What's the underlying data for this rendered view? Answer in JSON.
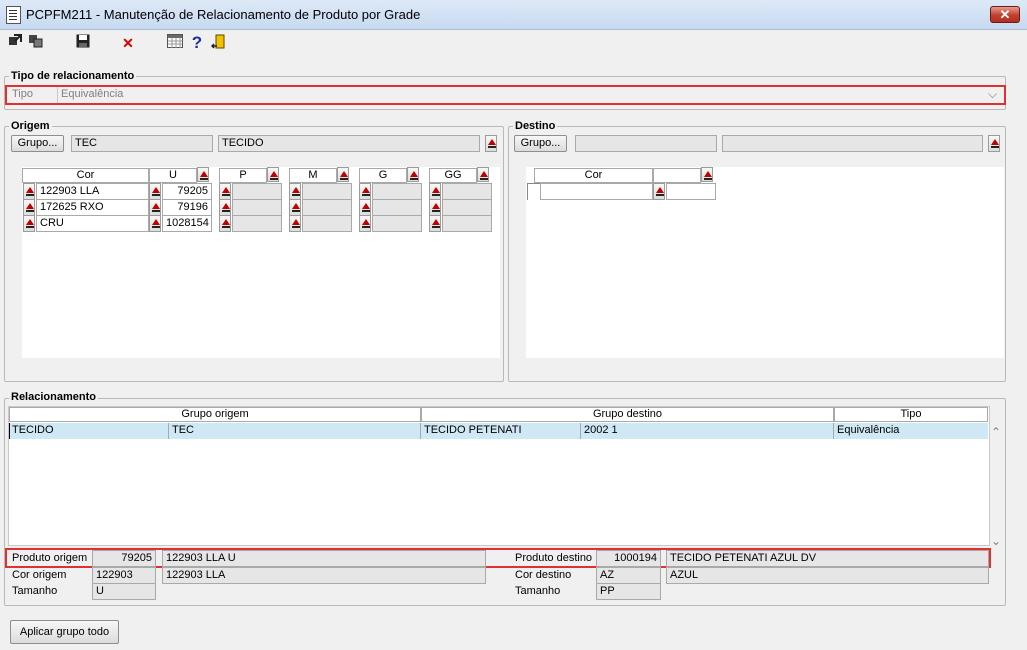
{
  "window": {
    "title": "PCPFM211 - Manutenção de Relacionamento de Produto por Grade",
    "close_label": "✕"
  },
  "toolbar": {
    "icons": [
      "export-icon",
      "copy-icon",
      "save-icon",
      "delete-icon",
      "calendar-icon",
      "help-icon",
      "exit-icon"
    ],
    "delete_glyph": "✕",
    "help_glyph": "?"
  },
  "tipo_rel": {
    "legend": "Tipo de relacionamento",
    "label": "Tipo",
    "value": "Equivalência",
    "arrow": "⌵"
  },
  "origem": {
    "legend": "Origem",
    "grupo_button": "Grupo...",
    "grupo_code": "TEC",
    "grupo_name": "TECIDO",
    "columns": [
      "Cor",
      "U",
      "P",
      "M",
      "G",
      "GG"
    ],
    "rows": [
      {
        "cor": "122903 LLA",
        "u": "79205"
      },
      {
        "cor": "172625 RXO",
        "u": "79196"
      },
      {
        "cor": "CRU",
        "u": "1028154"
      }
    ]
  },
  "destino": {
    "legend": "Destino",
    "grupo_button": "Grupo...",
    "grupo_code": "",
    "grupo_name": "",
    "columns": [
      "Cor"
    ]
  },
  "relacionamento": {
    "legend": "Relacionamento",
    "headers": {
      "grupo_origem": "Grupo origem",
      "grupo_destino": "Grupo destino",
      "tipo": "Tipo"
    },
    "rows": [
      {
        "orig_name": "TECIDO",
        "orig_code": "TEC",
        "dest_name": "TECIDO PETENATI",
        "dest_code": "2002 1",
        "tipo": "Equivalência"
      }
    ],
    "scroll_up": "⌃",
    "scroll_down": "⌄"
  },
  "details": {
    "produto_origem_label": "Produto origem",
    "produto_origem_code": "79205",
    "produto_origem_desc": "122903 LLA U",
    "cor_origem_label": "Cor origem",
    "cor_origem_code": "122903",
    "cor_origem_desc": "122903 LLA",
    "tamanho_origem_label": "Tamanho",
    "tamanho_origem": "U",
    "produto_destino_label": "Produto destino",
    "produto_destino_code": "1000194",
    "produto_destino_desc": "TECIDO PETENATI AZUL DV",
    "cor_destino_label": "Cor destino",
    "cor_destino_code": "AZ",
    "cor_destino_desc": "AZUL",
    "tamanho_destino_label": "Tamanho",
    "tamanho_destino": "PP"
  },
  "footer": {
    "aplicar_button": "Aplicar grupo todo"
  },
  "colors": {
    "highlight_red": "#e03131",
    "selected_row": "#cfe8f5",
    "title_bar": "#c7daf1"
  }
}
